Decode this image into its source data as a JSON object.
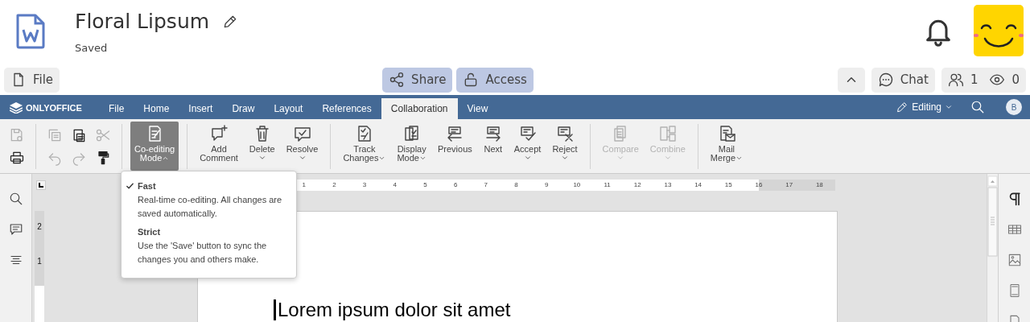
{
  "header": {
    "title": "Floral Lipsum",
    "status": "Saved"
  },
  "actions": {
    "file": "File",
    "share": "Share",
    "access": "Access",
    "chat": "Chat",
    "editors": "1",
    "viewers": "0"
  },
  "menu_bar": {
    "logo": "ONLYOFFICE",
    "mode": "Editing",
    "user_initial": "B",
    "tabs": [
      {
        "label": "File",
        "selected": false
      },
      {
        "label": "Home",
        "selected": false
      },
      {
        "label": "Insert",
        "selected": false
      },
      {
        "label": "Draw",
        "selected": false
      },
      {
        "label": "Layout",
        "selected": false
      },
      {
        "label": "References",
        "selected": false
      },
      {
        "label": "Collaboration",
        "selected": true
      },
      {
        "label": "View",
        "selected": false
      }
    ]
  },
  "toolbar": {
    "small_groups": [
      [
        {
          "disabled": true
        },
        {
          "disabled": false
        }
      ],
      [
        {
          "disabled": true
        },
        {
          "disabled": true
        },
        {
          "disabled": false
        },
        {
          "disabled": true
        },
        {
          "disabled": true
        },
        {
          "disabled": false
        }
      ]
    ],
    "big_groups": [
      [
        {
          "label": [
            "Co-editing",
            "Mode"
          ],
          "caret": true,
          "pressed": true,
          "disabled": false
        }
      ],
      [
        {
          "label": [
            "Add",
            "Comment"
          ],
          "caret": false,
          "pressed": false,
          "disabled": false
        },
        {
          "label": [
            "Delete"
          ],
          "caret": true,
          "pressed": false,
          "disabled": false
        },
        {
          "label": [
            "Resolve"
          ],
          "caret": true,
          "pressed": false,
          "disabled": false
        }
      ],
      [
        {
          "label": [
            "Track",
            "Changes"
          ],
          "caret": true,
          "pressed": false,
          "disabled": false
        },
        {
          "label": [
            "Display",
            "Mode"
          ],
          "caret": true,
          "pressed": false,
          "disabled": false
        },
        {
          "label": [
            "Previous"
          ],
          "caret": false,
          "pressed": false,
          "disabled": false
        },
        {
          "label": [
            "Next"
          ],
          "caret": false,
          "pressed": false,
          "disabled": false
        },
        {
          "label": [
            "Accept"
          ],
          "caret": true,
          "pressed": false,
          "disabled": false
        },
        {
          "label": [
            "Reject"
          ],
          "caret": true,
          "pressed": false,
          "disabled": false
        }
      ],
      [
        {
          "label": [
            "Compare"
          ],
          "caret": true,
          "pressed": false,
          "disabled": true
        },
        {
          "label": [
            "Combine"
          ],
          "caret": true,
          "pressed": false,
          "disabled": true
        }
      ],
      [
        {
          "label": [
            "Mail",
            "Merge"
          ],
          "caret": true,
          "pressed": false,
          "disabled": false
        }
      ]
    ]
  },
  "coediting_menu": [
    {
      "title": "Fast",
      "description": "Real-time co-editing. All changes are saved automatically.",
      "selected": true
    },
    {
      "title": "Strict",
      "description": "Use the 'Save' button to sync the changes you and others make.",
      "selected": false
    }
  ],
  "ruler": {
    "horizontal": [
      "1",
      "2",
      "3",
      "4",
      "5",
      "6",
      "7",
      "8",
      "9",
      "10",
      "11",
      "12",
      "13",
      "14",
      "15",
      "16",
      "17",
      "18"
    ],
    "vertical": [
      "2",
      "1"
    ]
  },
  "document": {
    "text": "Lorem ipsum dolor sit amet"
  }
}
